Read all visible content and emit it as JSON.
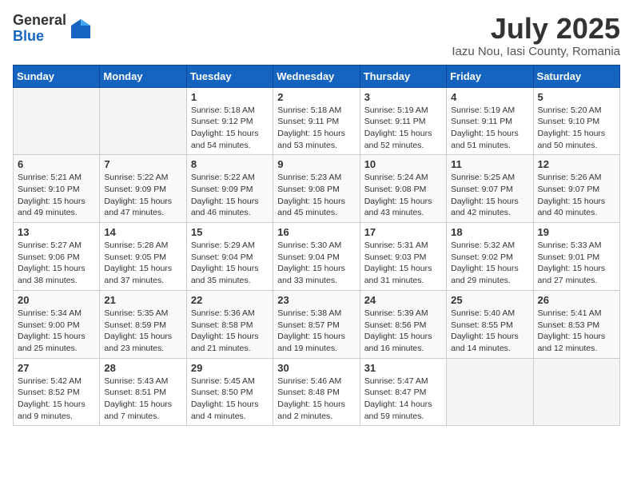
{
  "logo": {
    "general": "General",
    "blue": "Blue"
  },
  "title": "July 2025",
  "subtitle": "Iazu Nou, Iasi County, Romania",
  "weekdays": [
    "Sunday",
    "Monday",
    "Tuesday",
    "Wednesday",
    "Thursday",
    "Friday",
    "Saturday"
  ],
  "weeks": [
    [
      {
        "day": "",
        "info": ""
      },
      {
        "day": "",
        "info": ""
      },
      {
        "day": "1",
        "info": "Sunrise: 5:18 AM\nSunset: 9:12 PM\nDaylight: 15 hours\nand 54 minutes."
      },
      {
        "day": "2",
        "info": "Sunrise: 5:18 AM\nSunset: 9:11 PM\nDaylight: 15 hours\nand 53 minutes."
      },
      {
        "day": "3",
        "info": "Sunrise: 5:19 AM\nSunset: 9:11 PM\nDaylight: 15 hours\nand 52 minutes."
      },
      {
        "day": "4",
        "info": "Sunrise: 5:19 AM\nSunset: 9:11 PM\nDaylight: 15 hours\nand 51 minutes."
      },
      {
        "day": "5",
        "info": "Sunrise: 5:20 AM\nSunset: 9:10 PM\nDaylight: 15 hours\nand 50 minutes."
      }
    ],
    [
      {
        "day": "6",
        "info": "Sunrise: 5:21 AM\nSunset: 9:10 PM\nDaylight: 15 hours\nand 49 minutes."
      },
      {
        "day": "7",
        "info": "Sunrise: 5:22 AM\nSunset: 9:09 PM\nDaylight: 15 hours\nand 47 minutes."
      },
      {
        "day": "8",
        "info": "Sunrise: 5:22 AM\nSunset: 9:09 PM\nDaylight: 15 hours\nand 46 minutes."
      },
      {
        "day": "9",
        "info": "Sunrise: 5:23 AM\nSunset: 9:08 PM\nDaylight: 15 hours\nand 45 minutes."
      },
      {
        "day": "10",
        "info": "Sunrise: 5:24 AM\nSunset: 9:08 PM\nDaylight: 15 hours\nand 43 minutes."
      },
      {
        "day": "11",
        "info": "Sunrise: 5:25 AM\nSunset: 9:07 PM\nDaylight: 15 hours\nand 42 minutes."
      },
      {
        "day": "12",
        "info": "Sunrise: 5:26 AM\nSunset: 9:07 PM\nDaylight: 15 hours\nand 40 minutes."
      }
    ],
    [
      {
        "day": "13",
        "info": "Sunrise: 5:27 AM\nSunset: 9:06 PM\nDaylight: 15 hours\nand 38 minutes."
      },
      {
        "day": "14",
        "info": "Sunrise: 5:28 AM\nSunset: 9:05 PM\nDaylight: 15 hours\nand 37 minutes."
      },
      {
        "day": "15",
        "info": "Sunrise: 5:29 AM\nSunset: 9:04 PM\nDaylight: 15 hours\nand 35 minutes."
      },
      {
        "day": "16",
        "info": "Sunrise: 5:30 AM\nSunset: 9:04 PM\nDaylight: 15 hours\nand 33 minutes."
      },
      {
        "day": "17",
        "info": "Sunrise: 5:31 AM\nSunset: 9:03 PM\nDaylight: 15 hours\nand 31 minutes."
      },
      {
        "day": "18",
        "info": "Sunrise: 5:32 AM\nSunset: 9:02 PM\nDaylight: 15 hours\nand 29 minutes."
      },
      {
        "day": "19",
        "info": "Sunrise: 5:33 AM\nSunset: 9:01 PM\nDaylight: 15 hours\nand 27 minutes."
      }
    ],
    [
      {
        "day": "20",
        "info": "Sunrise: 5:34 AM\nSunset: 9:00 PM\nDaylight: 15 hours\nand 25 minutes."
      },
      {
        "day": "21",
        "info": "Sunrise: 5:35 AM\nSunset: 8:59 PM\nDaylight: 15 hours\nand 23 minutes."
      },
      {
        "day": "22",
        "info": "Sunrise: 5:36 AM\nSunset: 8:58 PM\nDaylight: 15 hours\nand 21 minutes."
      },
      {
        "day": "23",
        "info": "Sunrise: 5:38 AM\nSunset: 8:57 PM\nDaylight: 15 hours\nand 19 minutes."
      },
      {
        "day": "24",
        "info": "Sunrise: 5:39 AM\nSunset: 8:56 PM\nDaylight: 15 hours\nand 16 minutes."
      },
      {
        "day": "25",
        "info": "Sunrise: 5:40 AM\nSunset: 8:55 PM\nDaylight: 15 hours\nand 14 minutes."
      },
      {
        "day": "26",
        "info": "Sunrise: 5:41 AM\nSunset: 8:53 PM\nDaylight: 15 hours\nand 12 minutes."
      }
    ],
    [
      {
        "day": "27",
        "info": "Sunrise: 5:42 AM\nSunset: 8:52 PM\nDaylight: 15 hours\nand 9 minutes."
      },
      {
        "day": "28",
        "info": "Sunrise: 5:43 AM\nSunset: 8:51 PM\nDaylight: 15 hours\nand 7 minutes."
      },
      {
        "day": "29",
        "info": "Sunrise: 5:45 AM\nSunset: 8:50 PM\nDaylight: 15 hours\nand 4 minutes."
      },
      {
        "day": "30",
        "info": "Sunrise: 5:46 AM\nSunset: 8:48 PM\nDaylight: 15 hours\nand 2 minutes."
      },
      {
        "day": "31",
        "info": "Sunrise: 5:47 AM\nSunset: 8:47 PM\nDaylight: 14 hours\nand 59 minutes."
      },
      {
        "day": "",
        "info": ""
      },
      {
        "day": "",
        "info": ""
      }
    ]
  ]
}
